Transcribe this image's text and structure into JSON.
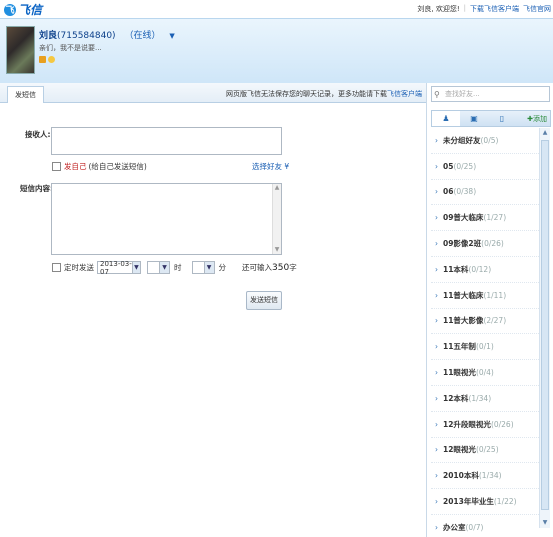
{
  "app": {
    "logo_mark": "飞",
    "logo_text": "飞信"
  },
  "topbar": {
    "welcome": "刘良, 欢迎您!",
    "links": [
      "下载飞信客户端",
      "飞信官网"
    ]
  },
  "profile": {
    "name": "刘良",
    "number": "(715584840)",
    "status": "（在线）",
    "signature": "亲们，我不是说要...",
    "signature_full": "亲们，我不是说要..."
  },
  "tabs": {
    "send_sms": "发短信"
  },
  "notice": {
    "text": "网页版飞信无法保存您的聊天记录，更多功能请下载",
    "link": "飞信客户端"
  },
  "form": {
    "receiver_label": "接收人:",
    "self_main": "发自己",
    "self_note": "(给自己发送短信)",
    "pick_friends": "选择好友",
    "content_label": "短信内容:",
    "timer_label": "定时发送",
    "date": "2013-03-07",
    "hour_unit": "时",
    "minute_unit": "分",
    "remain_prefix": "还可输入",
    "remain_count": "350",
    "remain_suffix": "字",
    "send_button": "发送短信"
  },
  "sidebar": {
    "search_placeholder": "查找好友...",
    "add_label": "添加",
    "groups": [
      {
        "name": "未分组好友",
        "count": "(0/5)"
      },
      {
        "name": "05",
        "count": "(0/25)"
      },
      {
        "name": "06",
        "count": "(0/38)"
      },
      {
        "name": "09普大临床",
        "count": "(1/27)"
      },
      {
        "name": "09影像2班",
        "count": "(0/26)"
      },
      {
        "name": "11本科",
        "count": "(0/12)"
      },
      {
        "name": "11普大临床",
        "count": "(1/11)"
      },
      {
        "name": "11普大影像",
        "count": "(2/27)"
      },
      {
        "name": "11五年制",
        "count": "(0/1)"
      },
      {
        "name": "11眼视光",
        "count": "(0/4)"
      },
      {
        "name": "12本科",
        "count": "(1/34)"
      },
      {
        "name": "12升段眼视光",
        "count": "(0/26)"
      },
      {
        "name": "12眼视光",
        "count": "(0/25)"
      },
      {
        "name": "2010本科",
        "count": "(1/34)"
      },
      {
        "name": "2013年毕业生",
        "count": "(1/22)"
      },
      {
        "name": "办公室",
        "count": "(0/7)"
      }
    ]
  }
}
